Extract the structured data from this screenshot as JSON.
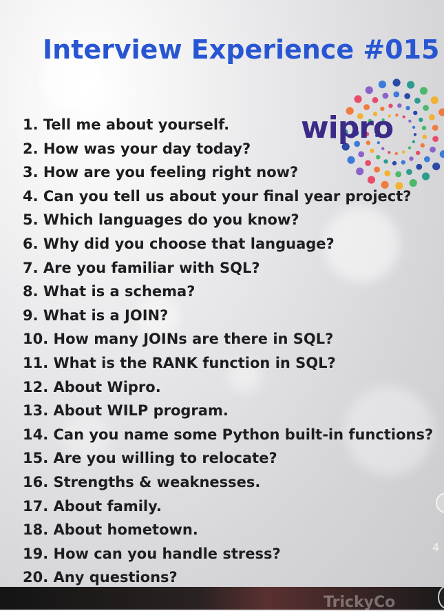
{
  "title": "Interview Experience #015",
  "logo": {
    "text": "wipro",
    "colors": [
      "#2d9c8f",
      "#4bb86a",
      "#f2b233",
      "#f07b3f",
      "#e84c6c",
      "#8a63c8",
      "#3e7bd8",
      "#2b4aa8"
    ]
  },
  "questions": [
    "1. Tell me about yourself.",
    "2. How was your day today?",
    "3. How are you feeling right now?",
    "4. Can you tell us about your final year project?",
    "5. Which languages do you know?",
    "6. Why did you choose that language?",
    "7. Are you familiar with SQL?",
    "8. What is a schema?",
    "9. What is a JOIN?",
    "10. How many JOINs are there in SQL?",
    "11. What is the RANK function in SQL?",
    "12. About Wipro.",
    "13. About WILP program.",
    "14. Can you name some Python built-in functions?",
    "15. Are you willing to relocate?",
    "16. Strengths & weaknesses.",
    "17. About family.",
    "18. About hometown.",
    "19. How can you handle stress?",
    "20. Any questions?"
  ],
  "overlay": {
    "count_text": "4",
    "bottom_text": "TrickyCo"
  }
}
